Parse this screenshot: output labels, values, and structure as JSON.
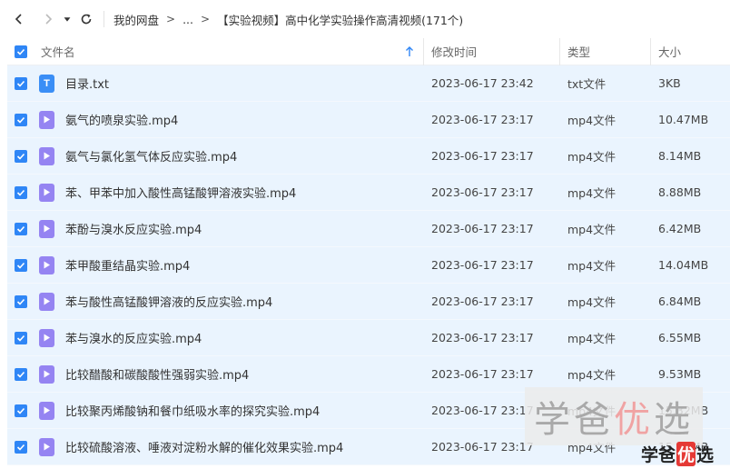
{
  "breadcrumb": {
    "root": "我的网盘",
    "ellipsis": "...",
    "current": "【实验视频】高中化学实验操作高清视频(171个)",
    "separator": ">"
  },
  "columns": {
    "name": "文件名",
    "time": "修改时间",
    "type": "类型",
    "size": "大小"
  },
  "files": [
    {
      "icon": "T",
      "kind": "txt",
      "name": "目录.txt",
      "time": "2023-06-17 23:42",
      "type": "txt文件",
      "size": "3KB"
    },
    {
      "kind": "mp4",
      "name": "氨气的喷泉实验.mp4",
      "time": "2023-06-17 23:17",
      "type": "mp4文件",
      "size": "10.47MB"
    },
    {
      "kind": "mp4",
      "name": "氨气与氯化氢气体反应实验.mp4",
      "time": "2023-06-17 23:17",
      "type": "mp4文件",
      "size": "8.14MB"
    },
    {
      "kind": "mp4",
      "name": "苯、甲苯中加入酸性高锰酸钾溶液实验.mp4",
      "time": "2023-06-17 23:17",
      "type": "mp4文件",
      "size": "8.88MB"
    },
    {
      "kind": "mp4",
      "name": "苯酚与溴水反应实验.mp4",
      "time": "2023-06-17 23:17",
      "type": "mp4文件",
      "size": "6.42MB"
    },
    {
      "kind": "mp4",
      "name": "苯甲酸重结晶实验.mp4",
      "time": "2023-06-17 23:17",
      "type": "mp4文件",
      "size": "14.04MB"
    },
    {
      "kind": "mp4",
      "name": "苯与酸性高锰酸钾溶液的反应实验.mp4",
      "time": "2023-06-17 23:17",
      "type": "mp4文件",
      "size": "6.84MB"
    },
    {
      "kind": "mp4",
      "name": "苯与溴水的反应实验.mp4",
      "time": "2023-06-17 23:17",
      "type": "mp4文件",
      "size": "6.55MB"
    },
    {
      "kind": "mp4",
      "name": "比较醋酸和碳酸酸性强弱实验.mp4",
      "time": "2023-06-17 23:17",
      "type": "mp4文件",
      "size": "9.53MB"
    },
    {
      "kind": "mp4",
      "name": "比较聚丙烯酸钠和餐巾纸吸水率的探究实验.mp4",
      "time": "2023-06-17 23:17",
      "type": "mp4文件",
      "size": "15.32MB"
    },
    {
      "kind": "mp4",
      "name": "比较硫酸溶液、唾液对淀粉水解的催化效果实验.mp4",
      "time": "2023-06-17 23:17",
      "type": "mp4文件",
      "size": "15.33MB"
    }
  ],
  "watermark": {
    "big_a": "学爸",
    "big_b": "优",
    "big_c": "选",
    "small_a": "学爸",
    "small_b": "优",
    "small_c": "选"
  },
  "colors": {
    "accent": "#2f86f6",
    "row_bg": "#eaf4fe",
    "video_icon": "#9584f2"
  }
}
